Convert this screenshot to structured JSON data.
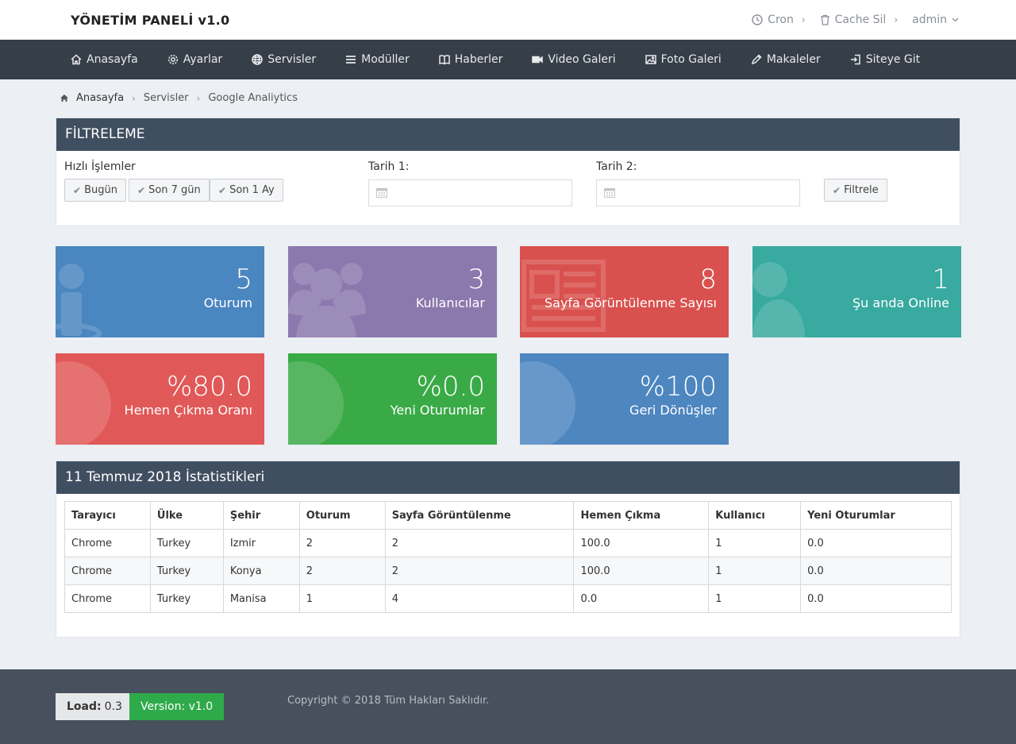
{
  "header": {
    "brand": "YÖNETİM PANELİ v1.0",
    "links": [
      {
        "label": "Cron",
        "icon": "clock-icon"
      },
      {
        "label": "Cache Sil",
        "icon": "trash-icon"
      },
      {
        "label": "admin",
        "icon": "chevron-down-icon"
      }
    ]
  },
  "nav": {
    "items": [
      {
        "label": "Anasayfa",
        "icon": "home-icon"
      },
      {
        "label": "Ayarlar",
        "icon": "gear-icon"
      },
      {
        "label": "Servisler",
        "icon": "globe-icon"
      },
      {
        "label": "Modüller",
        "icon": "menu-icon"
      },
      {
        "label": "Haberler",
        "icon": "book-icon"
      },
      {
        "label": "Video Galeri",
        "icon": "video-icon"
      },
      {
        "label": "Foto Galeri",
        "icon": "image-icon"
      },
      {
        "label": "Makaleler",
        "icon": "pencil-icon"
      },
      {
        "label": "Siteye Git",
        "icon": "sign-in-icon"
      }
    ]
  },
  "breadcrumb": [
    "Anasayfa",
    "Servisler",
    "Google Analiytics"
  ],
  "filter": {
    "title": "FİLTRELEME",
    "quick_label": "Hızlı İşlemler",
    "quick_buttons": [
      "Bugün",
      "Son 7 gün",
      "Son 1 Ay"
    ],
    "date1_label": "Tarih 1:",
    "date2_label": "Tarih 2:",
    "date1_value": "",
    "date2_value": "",
    "submit_label": "Filtrele"
  },
  "cards": [
    {
      "value": "5",
      "label": "Oturum",
      "color": "#4a86c0",
      "icon": "user-icon"
    },
    {
      "value": "3",
      "label": "Kullanıcılar",
      "color": "#8b78ad",
      "icon": "users-icon"
    },
    {
      "value": "8",
      "label": "Sayfa Görüntülenme Sayısı",
      "color": "#d9514e",
      "icon": "newspaper-icon"
    },
    {
      "value": "1",
      "label": "Şu anda Online",
      "color": "#38aaa0",
      "icon": "user-icon"
    },
    {
      "value": "%80.0",
      "label": "Hemen Çıkma Oranı",
      "color": "#e15858",
      "icon": "globe-icon"
    },
    {
      "value": "%0.0",
      "label": "Yeni Oturumlar",
      "color": "#3aaa47",
      "icon": "globe-icon"
    },
    {
      "value": "%100",
      "label": "Geri Dönüşler",
      "color": "#4e86c0",
      "icon": "globe-icon"
    }
  ],
  "stats": {
    "title": "11 Temmuz 2018 İstatistikleri",
    "columns": [
      "Tarayıcı",
      "Ülke",
      "Şehir",
      "Oturum",
      "Sayfa Görüntülenme",
      "Hemen Çıkma",
      "Kullanıcı",
      "Yeni Oturumlar"
    ],
    "rows": [
      [
        "Chrome",
        "Turkey",
        "Izmir",
        "2",
        "2",
        "100.0",
        "1",
        "0.0"
      ],
      [
        "Chrome",
        "Turkey",
        "Konya",
        "2",
        "2",
        "100.0",
        "1",
        "0.0"
      ],
      [
        "Chrome",
        "Turkey",
        "Manisa",
        "1",
        "4",
        "0.0",
        "1",
        "0.0"
      ]
    ]
  },
  "footer": {
    "load_label": "Load:",
    "load_value": "0.3",
    "version": "Version: v1.0",
    "copyright": "Copyright © 2018 Tüm Hakları Saklıdır."
  }
}
